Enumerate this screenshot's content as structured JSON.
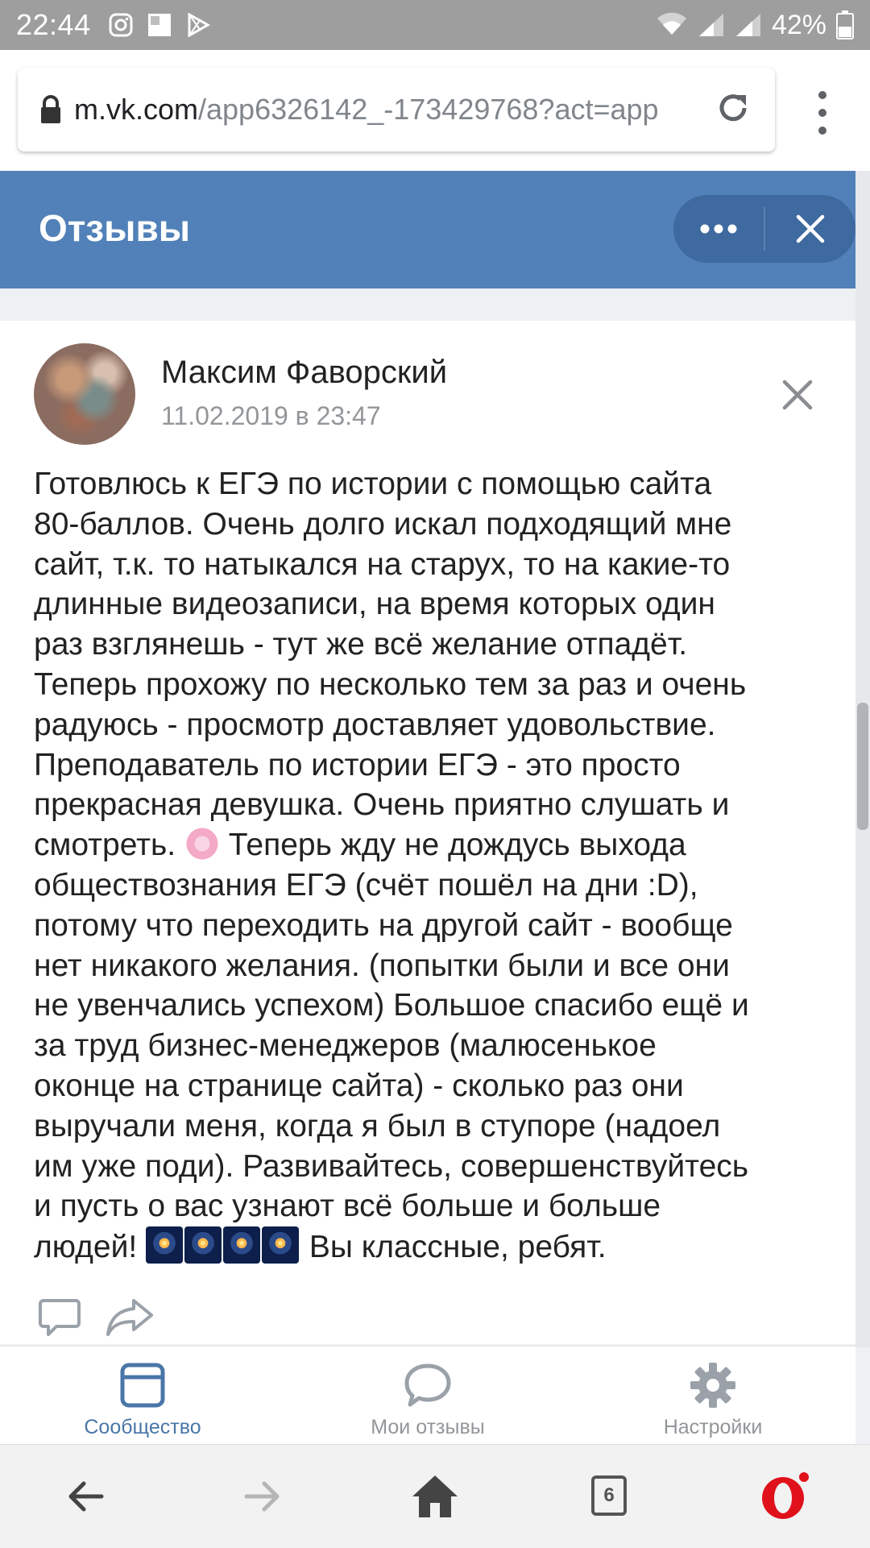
{
  "status_bar": {
    "time": "22:44",
    "battery": "42%"
  },
  "browser": {
    "url_domain": "m.vk.com",
    "url_path": "/app6326142_-173429768?act=app"
  },
  "app": {
    "title": "Отзывы"
  },
  "review": {
    "author": "Максим Фаворский",
    "date": "11.02.2019 в 23:47",
    "text_part1": "Готовлюсь к ЕГЭ по истории с помощью сайта\n80-баллов. Очень долго искал подходящий мне\nсайт, т.к. то натыкался на старух, то на какие-то\nдлинные видеозаписи, на время которых один\nраз взглянешь - тут же всё желание отпадёт.\nТеперь прохожу по несколько тем за раз и очень\nрадуюсь - просмотр доставляет удовольствие.\nПреподаватель по истории ЕГЭ - это просто\nпрекрасная девушка. Очень приятно слушать и\nсмотреть.",
    "text_part2": " Теперь жду не дождусь выхода\nобществознания ЕГЭ (счёт пошёл на дни :D),\nпотому что переходить на другой сайт - вообще\nнет никакого желания. (попытки были и все они\nне увенчались успехом) Большое спасибо ещё и\nза труд бизнес-менеджеров (малюсенькое\nоконце на странице сайта) - сколько раз они\nвыручали меня, когда я был в ступоре (надоел\nим уже поди). Развивайтесь, совершенствуйтесь\nи пусть о вас узнают всё больше и больше\nлюдей! ",
    "text_part3": " Вы классные, ребят.",
    "emoji_1": "cherry-blossom-emoji",
    "emoji_2": "fireworks-emoji"
  },
  "tabs": [
    {
      "label": "Сообщество",
      "icon": "community-icon",
      "active": true
    },
    {
      "label": "Мои отзывы",
      "icon": "speech-bubble-icon",
      "active": false
    },
    {
      "label": "Настройки",
      "icon": "gear-icon",
      "active": false
    }
  ],
  "browser_nav": {
    "tab_count": "6"
  },
  "colors": {
    "header": "#5181b8",
    "pill": "#3e6aa0",
    "active_tab": "#4a76a8",
    "inactive": "#939699",
    "opera_red": "#e0111b"
  }
}
